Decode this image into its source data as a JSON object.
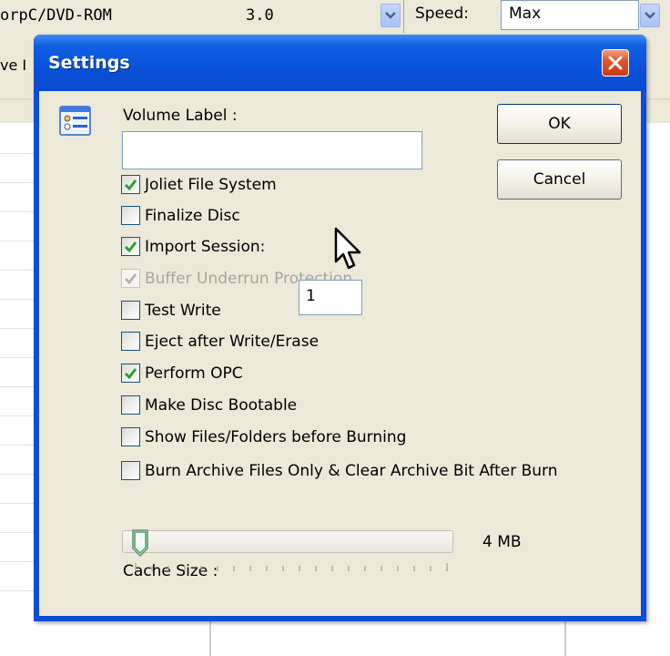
{
  "background": {
    "device": "orpC/DVD-ROM",
    "version": "3.0",
    "speed_label": "Speed:",
    "speed_value": "Max",
    "tab_fragment": "ve I"
  },
  "dialog": {
    "title": "Settings",
    "volume_label": "Volume Label :",
    "volume_value": "",
    "ok_label": "OK",
    "cancel_label": "Cancel",
    "options": [
      {
        "label": "Joliet File System",
        "checked": true,
        "enabled": true
      },
      {
        "label": "Finalize Disc",
        "checked": false,
        "enabled": true
      },
      {
        "label": "Import Session:",
        "checked": true,
        "enabled": true
      },
      {
        "label": "Buffer Underrun Protection",
        "checked": true,
        "enabled": false
      },
      {
        "label": "Test Write",
        "checked": false,
        "enabled": true
      },
      {
        "label": "Eject after Write/Erase",
        "checked": false,
        "enabled": true
      },
      {
        "label": "Perform OPC",
        "checked": true,
        "enabled": true
      },
      {
        "label": "Make Disc Bootable",
        "checked": false,
        "enabled": true
      },
      {
        "label": "Show Files/Folders before Burning",
        "checked": false,
        "enabled": true
      },
      {
        "label": "Burn Archive Files Only & Clear Archive Bit After Burn",
        "checked": false,
        "enabled": true
      }
    ],
    "import_session_value": "1",
    "cache_size_label": "Cache Size :",
    "cache_size_value": "4 MB",
    "cache_slider_fraction": 0.0
  },
  "colors": {
    "titlebar": "#0a4fdb",
    "client": "#ece9d8",
    "checkmark": "#21a121",
    "close_button": "#e0562d"
  },
  "icons": [
    "settings-form-icon",
    "close-icon",
    "combo-arrow-icon",
    "checkmark-icon",
    "slider-thumb-icon",
    "mouse-cursor-icon"
  ]
}
